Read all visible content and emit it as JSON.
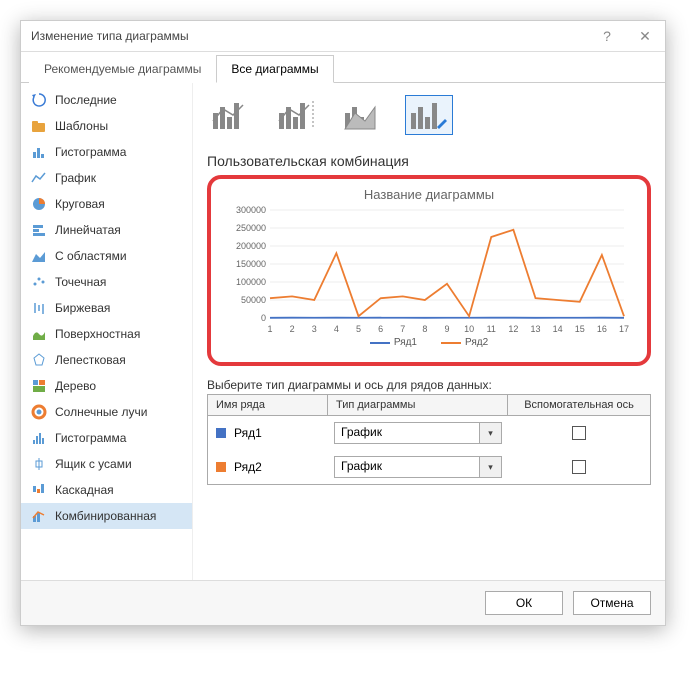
{
  "title": "Изменение типа диаграммы",
  "tabs": [
    {
      "label": "Рекомендуемые диаграммы",
      "active": false
    },
    {
      "label": "Все диаграммы",
      "active": true
    }
  ],
  "sidebar": {
    "items": [
      {
        "label": "Последние",
        "icon": "recent"
      },
      {
        "label": "Шаблоны",
        "icon": "templates"
      },
      {
        "label": "Гистограмма",
        "icon": "bar"
      },
      {
        "label": "График",
        "icon": "line"
      },
      {
        "label": "Круговая",
        "icon": "pie"
      },
      {
        "label": "Линейчатая",
        "icon": "hbar"
      },
      {
        "label": "С областями",
        "icon": "area"
      },
      {
        "label": "Точечная",
        "icon": "scatter"
      },
      {
        "label": "Биржевая",
        "icon": "stock"
      },
      {
        "label": "Поверхностная",
        "icon": "surface"
      },
      {
        "label": "Лепестковая",
        "icon": "radar"
      },
      {
        "label": "Дерево",
        "icon": "tree"
      },
      {
        "label": "Солнечные лучи",
        "icon": "sunburst"
      },
      {
        "label": "Гистограмма",
        "icon": "histogram"
      },
      {
        "label": "Ящик с усами",
        "icon": "box"
      },
      {
        "label": "Каскадная",
        "icon": "waterfall"
      },
      {
        "label": "Комбинированная",
        "icon": "combo",
        "selected": true
      }
    ]
  },
  "section_title": "Пользовательская комбинация",
  "chart_data": {
    "type": "line",
    "title": "Название диаграммы",
    "xlabel": "",
    "ylabel": "",
    "ylim": [
      0,
      300000
    ],
    "x": [
      1,
      2,
      3,
      4,
      5,
      6,
      7,
      8,
      9,
      10,
      11,
      12,
      13,
      14,
      15,
      16,
      17
    ],
    "y_ticks": [
      0,
      50000,
      100000,
      150000,
      200000,
      250000,
      300000
    ],
    "series": [
      {
        "name": "Ряд1",
        "color": "#4472c4",
        "values": [
          500,
          800,
          600,
          900,
          700,
          800,
          600,
          500,
          700,
          600,
          800,
          900,
          500,
          600,
          700,
          800,
          500
        ]
      },
      {
        "name": "Ряд2",
        "color": "#ed7d31",
        "values": [
          55000,
          60000,
          50000,
          180000,
          5000,
          55000,
          60000,
          50000,
          95000,
          5000,
          225000,
          245000,
          55000,
          50000,
          45000,
          175000,
          5000
        ]
      }
    ]
  },
  "config_label": "Выберите тип диаграммы и ось для рядов данных:",
  "config_headers": {
    "name": "Имя ряда",
    "type": "Тип диаграммы",
    "aux": "Вспомогательная ось"
  },
  "config_rows": [
    {
      "color": "#4472c4",
      "name": "Ряд1",
      "type": "График",
      "aux": false
    },
    {
      "color": "#ed7d31",
      "name": "Ряд2",
      "type": "График",
      "aux": false
    }
  ],
  "buttons": {
    "ok": "ОК",
    "cancel": "Отмена"
  }
}
